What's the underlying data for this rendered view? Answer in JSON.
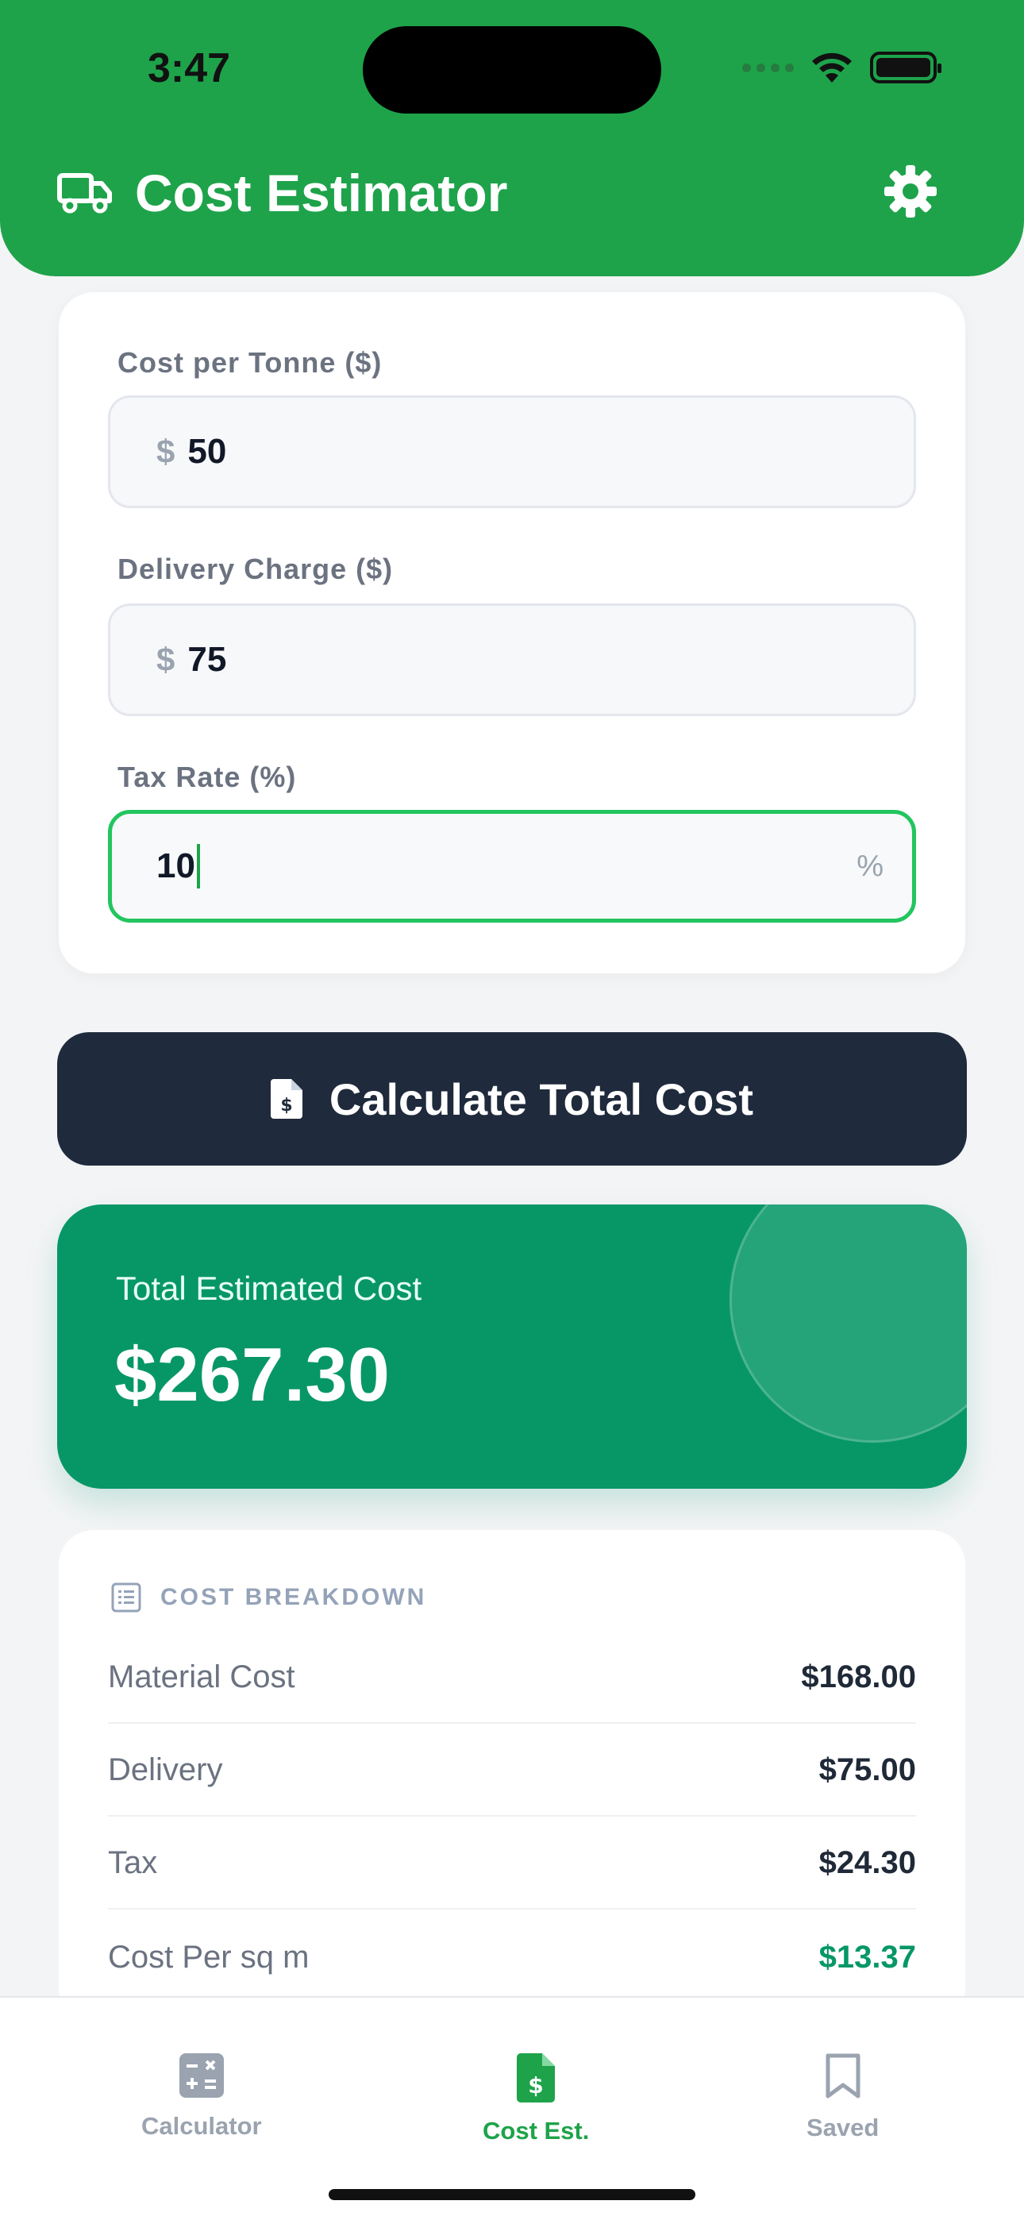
{
  "status": {
    "time": "3:47"
  },
  "header": {
    "title": "Cost Estimator",
    "truck_icon": "truck-icon",
    "settings_icon": "gear-icon"
  },
  "form": {
    "cost_per_tonne": {
      "label": "Cost per Tonne ($)",
      "prefix": "$",
      "value": "50"
    },
    "delivery_charge": {
      "label": "Delivery Charge ($)",
      "prefix": "$",
      "value": "75"
    },
    "tax_rate": {
      "label": "Tax Rate (%)",
      "value": "10",
      "suffix": "%"
    }
  },
  "calculate_button": {
    "label": "Calculate Total Cost",
    "icon": "invoice-dollar-icon"
  },
  "total": {
    "label": "Total Estimated Cost",
    "value": "$267.30"
  },
  "breakdown": {
    "title": "COST BREAKDOWN",
    "rows": [
      {
        "label": "Material Cost",
        "value": "$168.00"
      },
      {
        "label": "Delivery",
        "value": "$75.00"
      },
      {
        "label": "Tax",
        "value": "$24.30"
      },
      {
        "label": "Cost Per sq m",
        "value": "$13.37"
      }
    ]
  },
  "nav": {
    "items": [
      {
        "label": "Calculator",
        "icon": "calculator-icon",
        "active": false
      },
      {
        "label": "Cost Est.",
        "icon": "invoice-dollar-icon",
        "active": true
      },
      {
        "label": "Saved",
        "icon": "bookmark-icon",
        "active": false
      }
    ]
  },
  "colors": {
    "primary": "#1ea34a",
    "dark": "#1f2a3c",
    "total_bg": "#079767"
  }
}
